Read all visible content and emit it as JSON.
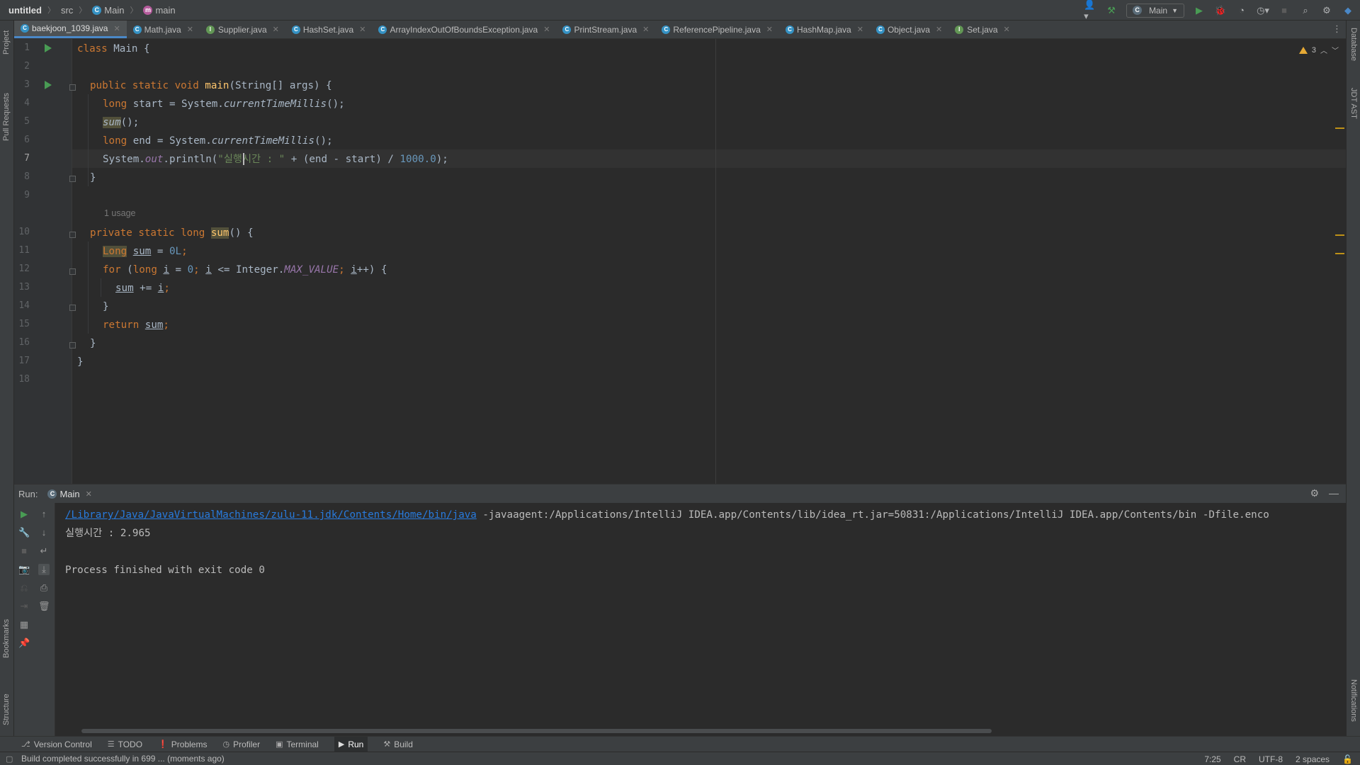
{
  "navbar": {
    "project": "untitled",
    "crumbs": [
      "src",
      "Main",
      "main"
    ],
    "run_config": "Main"
  },
  "left_strip": {
    "project": "Project",
    "pull_requests": "Pull Requests",
    "bookmarks": "Bookmarks",
    "structure": "Structure"
  },
  "right_strip": {
    "database": "Database",
    "jdt_ast": "JDT AST",
    "notifications": "Notifications"
  },
  "tabs": [
    {
      "label": "baekjoon_1039.java",
      "icon": "class-icon",
      "active": true
    },
    {
      "label": "Math.java",
      "icon": "class-icon"
    },
    {
      "label": "Supplier.java",
      "icon": "interface-icon"
    },
    {
      "label": "HashSet.java",
      "icon": "class-icon"
    },
    {
      "label": "ArrayIndexOutOfBoundsException.java",
      "icon": "class-icon"
    },
    {
      "label": "PrintStream.java",
      "icon": "class-icon"
    },
    {
      "label": "ReferencePipeline.java",
      "icon": "class-icon"
    },
    {
      "label": "HashMap.java",
      "icon": "class-icon"
    },
    {
      "label": "Object.java",
      "icon": "class-icon"
    },
    {
      "label": "Set.java",
      "icon": "interface-icon"
    }
  ],
  "editor": {
    "warnings_count": "3",
    "usage_hint": "1 usage",
    "line_numbers": [
      "1",
      "2",
      "3",
      "4",
      "5",
      "6",
      "7",
      "8",
      "9",
      "10",
      "11",
      "12",
      "13",
      "14",
      "15",
      "16",
      "17",
      "18"
    ],
    "code": {
      "l1": {
        "kw": "class",
        "name": " Main {"
      },
      "l3": {
        "kw": "public static void ",
        "fn": "main",
        "rest": "(String[] args) {"
      },
      "l4": {
        "kw": "long",
        "a": " start = System.",
        "m": "currentTimeMillis",
        "b": "();"
      },
      "l5": {
        "m": "sum",
        "b": "();"
      },
      "l6": {
        "kw": "long",
        "a": " end = System.",
        "m": "currentTimeMillis",
        "b": "();"
      },
      "l7": {
        "a": "System.",
        "f": "out",
        "b": ".println(",
        "s": "\"실행시간 : \"",
        "c": " + (end - start) / ",
        "n": "1000.0",
        "d": ");"
      },
      "l8": {
        "a": "}"
      },
      "l10": {
        "kw": "private static long ",
        "fn": "sum",
        "rest": "() {"
      },
      "l11": {
        "t": "Long",
        "v": "sum",
        "a": " = ",
        "n": "0L",
        "b": ";"
      },
      "l12": {
        "kw1": "for",
        "a": " (",
        "kw2": "long",
        "b": " ",
        "v1": "i",
        "c": " = ",
        "n": "0",
        "d": "; ",
        "v2": "i",
        "e": " <= Integer.",
        "f": "MAX_VALUE",
        "g": "; ",
        "v3": "i",
        "h": "++) {"
      },
      "l13": {
        "v": "sum",
        "a": " += ",
        "v2": "i",
        "b": ";"
      },
      "l14": {
        "a": "}"
      },
      "l15": {
        "kw": "return",
        "a": " ",
        "v": "sum",
        "b": ";"
      },
      "l16": {
        "a": "}"
      },
      "l17": {
        "a": "}"
      }
    }
  },
  "run_panel": {
    "title": "Run:",
    "tab_label": "Main",
    "console": {
      "cmd_path": "/Library/Java/JavaVirtualMachines/zulu-11.jdk/Contents/Home/bin/java",
      "cmd_args": " -javaagent:/Applications/IntelliJ IDEA.app/Contents/lib/idea_rt.jar=50831:/Applications/IntelliJ IDEA.app/Contents/bin -Dfile.enco",
      "output": "실행시간 : 2.965",
      "exit": "Process finished with exit code 0"
    }
  },
  "bottom_tools": [
    {
      "label": "Version Control",
      "icon": "branch-icon"
    },
    {
      "label": "TODO",
      "icon": "list-icon"
    },
    {
      "label": "Problems",
      "icon": "problems-icon"
    },
    {
      "label": "Profiler",
      "icon": "profiler-icon"
    },
    {
      "label": "Terminal",
      "icon": "terminal-icon"
    },
    {
      "label": "Run",
      "icon": "run-icon",
      "active": true
    },
    {
      "label": "Build",
      "icon": "hammer-icon"
    }
  ],
  "status": {
    "message": "Build completed successfully in 699 ... (moments ago)",
    "position": "7:25",
    "line_sep": "CR",
    "encoding": "UTF-8",
    "indent": "2 spaces"
  },
  "colors": {
    "accent": "#4a88c7",
    "run_green": "#499c54",
    "keyword": "#cc7832",
    "function": "#ffc66d",
    "string": "#6a8759",
    "number": "#6897bb",
    "field": "#9876aa"
  }
}
